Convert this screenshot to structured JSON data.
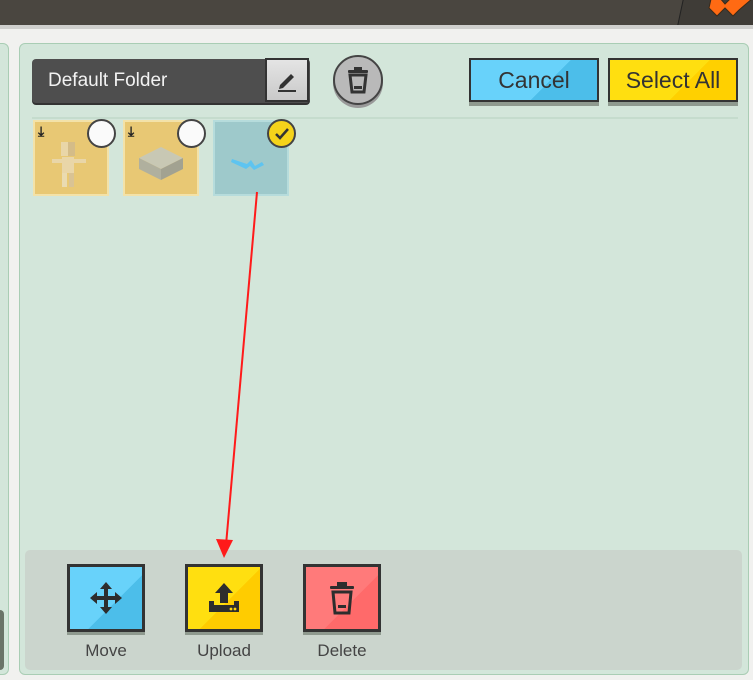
{
  "header": {
    "close_icon": "orange-x-icon"
  },
  "folder": {
    "name": "Default Folder",
    "edit_icon": "pencil-icon",
    "delete_icon": "trash-icon"
  },
  "toolbar": {
    "cancel_label": "Cancel",
    "select_all_label": "Select All"
  },
  "items": [
    {
      "type": "character-model",
      "downloadable": true,
      "selected": false
    },
    {
      "type": "block-model",
      "downloadable": true,
      "selected": false
    },
    {
      "type": "blue-shape-model",
      "downloadable": false,
      "selected": true
    }
  ],
  "actions": [
    {
      "label": "Move",
      "icon": "move-arrows-icon",
      "color": "#5cc9f5"
    },
    {
      "label": "Upload",
      "icon": "upload-icon",
      "color": "#ffd60a"
    },
    {
      "label": "Delete",
      "icon": "trash-icon",
      "color": "#ff7272"
    }
  ],
  "annotation": {
    "type": "arrow",
    "color": "#ff1a1a",
    "from": "selected-item",
    "to": "upload-button"
  }
}
